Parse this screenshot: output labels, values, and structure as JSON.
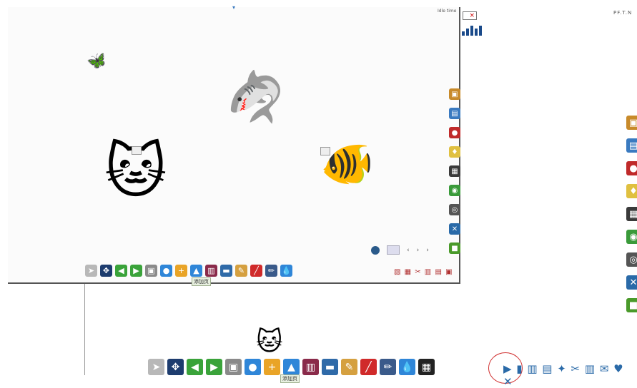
{
  "window": {
    "top_mark": "▾",
    "corner_label": "Idle time",
    "right_corner_label": "PF.T.N"
  },
  "canvas": {
    "pager": [
      "‹",
      "›",
      "›"
    ],
    "animals": [
      {
        "name": "butterfly",
        "glyph": "🦋"
      },
      {
        "name": "shark",
        "glyph": "🦈"
      },
      {
        "name": "cat",
        "glyph": "🐱"
      },
      {
        "name": "fish",
        "glyph": "🐠"
      }
    ]
  },
  "toolbar_small": {
    "tooltip": "添加页",
    "items": [
      {
        "name": "pointer",
        "glyph": "➤",
        "color": "#b8b8b8"
      },
      {
        "name": "grid",
        "glyph": "✥",
        "color": "#1d3c6e"
      },
      {
        "name": "back",
        "glyph": "◀",
        "color": "#3aa33a"
      },
      {
        "name": "forward",
        "glyph": "▶",
        "color": "#3aa33a"
      },
      {
        "name": "screenshot",
        "glyph": "▣",
        "color": "#8a8a8a"
      },
      {
        "name": "circle",
        "glyph": "●",
        "color": "#2f86d8"
      },
      {
        "name": "add-page",
        "glyph": "+",
        "color": "#e9a427"
      },
      {
        "name": "upload",
        "glyph": "▲",
        "color": "#2f86d8"
      },
      {
        "name": "book",
        "glyph": "▥",
        "color": "#8a2a4a"
      },
      {
        "name": "eraser",
        "glyph": "▬",
        "color": "#2f6aa8"
      },
      {
        "name": "pen-tool",
        "glyph": "✎",
        "color": "#d5a040"
      },
      {
        "name": "marker",
        "glyph": "╱",
        "color": "#d02a2a"
      },
      {
        "name": "pencil",
        "glyph": "✏",
        "color": "#3a5a8a"
      },
      {
        "name": "drop",
        "glyph": "💧",
        "color": "#2f86d8"
      }
    ]
  },
  "toolbar_large": {
    "tooltip": "添加页",
    "extra": {
      "name": "remote",
      "glyph": "▦",
      "color": "#222222"
    }
  },
  "sidebar_icons": [
    {
      "name": "picture",
      "glyph": "▣",
      "color": "#c88a2a"
    },
    {
      "name": "window",
      "glyph": "▤",
      "color": "#3a7ac0"
    },
    {
      "name": "record",
      "glyph": "●",
      "color": "#c02a2a"
    },
    {
      "name": "bulb",
      "glyph": "♦",
      "color": "#e0c040"
    },
    {
      "name": "film",
      "glyph": "▦",
      "color": "#3a3a3a"
    },
    {
      "name": "globe",
      "glyph": "◉",
      "color": "#3a9a3a"
    },
    {
      "name": "camera",
      "glyph": "◎",
      "color": "#555555"
    },
    {
      "name": "tools",
      "glyph": "✕",
      "color": "#2a6aa8"
    },
    {
      "name": "box",
      "glyph": "■",
      "color": "#4a9a2a"
    }
  ],
  "mini_right_small": {
    "glyph": "▧ ▦ ✂ ▥ ▤ ▣"
  },
  "mini_right_large": {
    "glyph": "▶ ▮ ▥ ▤ ✦ ✂ ▥ ✉ ♥ ✕"
  }
}
